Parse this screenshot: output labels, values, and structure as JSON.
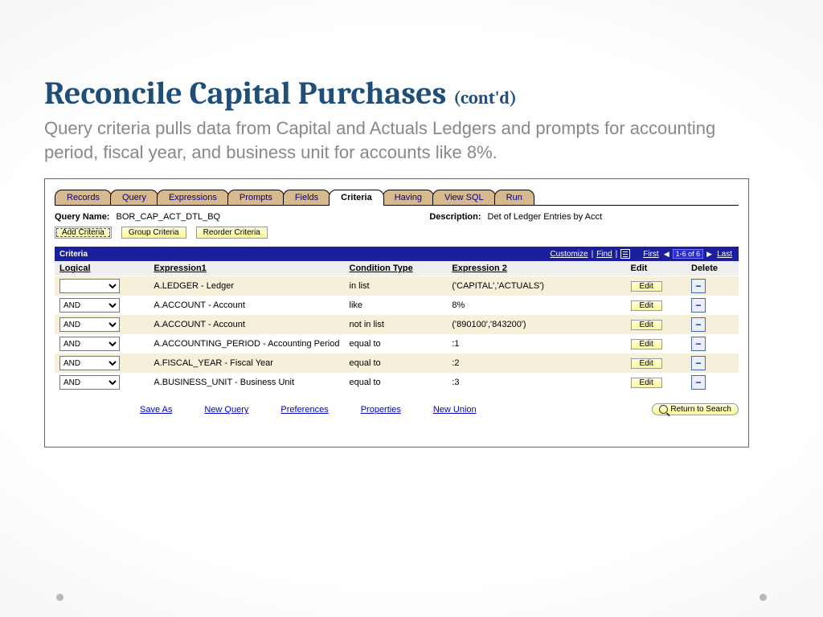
{
  "slide": {
    "title_main": "Reconcile Capital Purchases ",
    "title_cont": "(cont'd)",
    "subtitle": "Query criteria pulls data from Capital and Actuals Ledgers and prompts for accounting period, fiscal year, and business unit for accounts like 8%."
  },
  "tabs": [
    "Records",
    "Query",
    "Expressions",
    "Prompts",
    "Fields",
    "Criteria",
    "Having",
    "View SQL",
    "Run"
  ],
  "active_tab": "Criteria",
  "query": {
    "name_label": "Query Name:",
    "name_value": "BOR_CAP_ACT_DTL_BQ",
    "desc_label": "Description:",
    "desc_value": "Det of Ledger Entries by Acct"
  },
  "action_buttons": {
    "add": "Add Criteria",
    "group": "Group Criteria",
    "reorder": "Reorder Criteria"
  },
  "gridbar": {
    "title": "Criteria",
    "customize": "Customize",
    "find": "Find",
    "first": "First",
    "count": "1-6 of 6",
    "last": "Last"
  },
  "columns": {
    "logical": "Logical",
    "exp1": "Expression1",
    "cond": "Condition Type",
    "exp2": "Expression 2",
    "edit": "Edit",
    "delete": "Delete"
  },
  "rows": [
    {
      "logical": "",
      "exp1": "A.LEDGER - Ledger",
      "cond": "in list",
      "exp2": "('CAPITAL','ACTUALS')"
    },
    {
      "logical": "AND",
      "exp1": "A.ACCOUNT - Account",
      "cond": "like",
      "exp2": "8%"
    },
    {
      "logical": "AND",
      "exp1": "A.ACCOUNT - Account",
      "cond": "not in list",
      "exp2": "('890100','843200')"
    },
    {
      "logical": "AND",
      "exp1": "A.ACCOUNTING_PERIOD - Accounting Period",
      "cond": "equal to",
      "exp2": ":1"
    },
    {
      "logical": "AND",
      "exp1": "A.FISCAL_YEAR - Fiscal Year",
      "cond": "equal to",
      "exp2": ":2"
    },
    {
      "logical": "AND",
      "exp1": "A.BUSINESS_UNIT - Business Unit",
      "cond": "equal to",
      "exp2": ":3"
    }
  ],
  "edit_label": "Edit",
  "bottom_links": [
    "Save As",
    "New Query",
    "Preferences",
    "Properties",
    "New Union"
  ],
  "return_label": "Return to Search"
}
